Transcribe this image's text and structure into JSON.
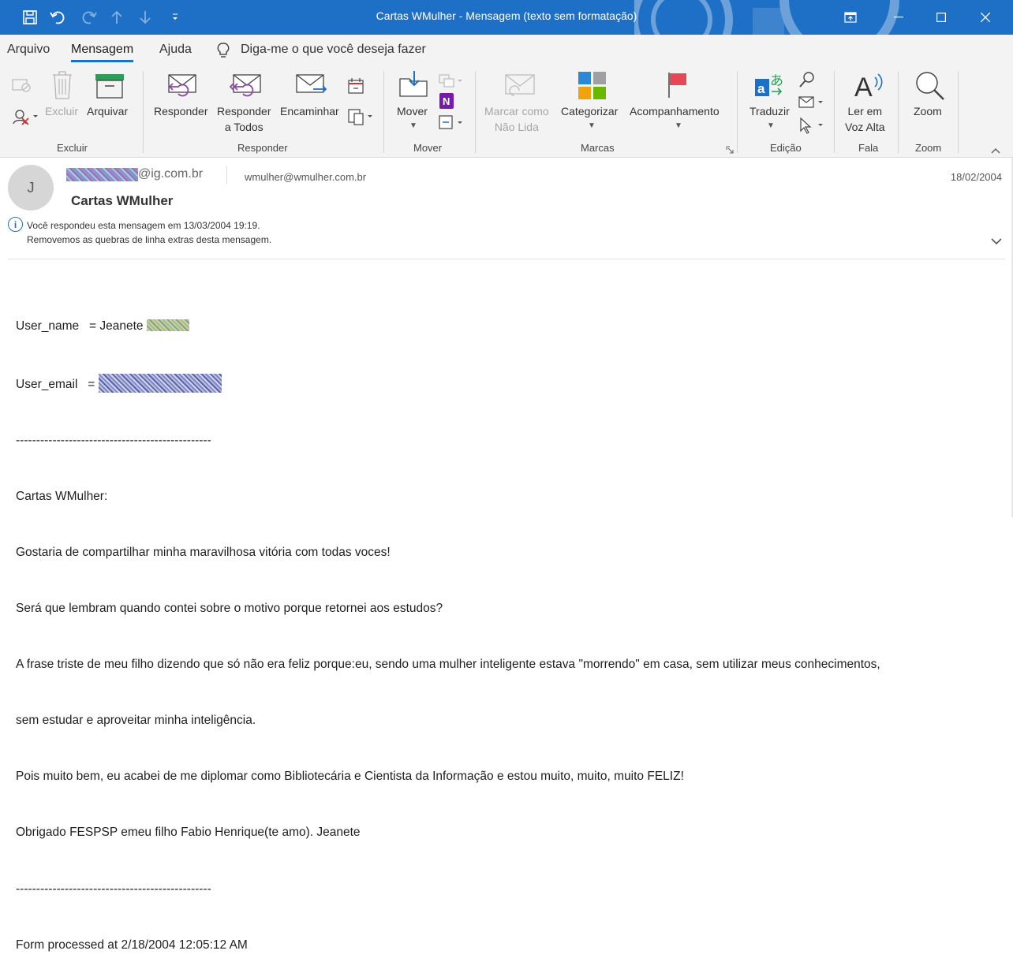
{
  "window": {
    "title": "Cartas WMulher  -  Mensagem (texto sem formatação)",
    "accent": "#1e6fc6"
  },
  "tabs": [
    {
      "label": "Arquivo"
    },
    {
      "label": "Mensagem"
    },
    {
      "label": "Ajuda"
    }
  ],
  "tell_me": "Diga-me o que você deseja fazer",
  "ribbon": {
    "excluir": {
      "delete_label": "Excluir",
      "archive_label": "Arquivar",
      "group": "Excluir"
    },
    "responder": {
      "reply": "Responder",
      "reply_all_1": "Responder",
      "reply_all_2": "a Todos",
      "forward": "Encaminhar",
      "group": "Responder"
    },
    "mover": {
      "move": "Mover",
      "group": "Mover"
    },
    "marcas": {
      "unread_1": "Marcar como",
      "unread_2": "Não Lida",
      "categorize": "Categorizar",
      "follow_up": "Acompanhamento",
      "group": "Marcas"
    },
    "edicao": {
      "translate": "Traduzir",
      "group": "Edição"
    },
    "fala": {
      "read_aloud_1": "Ler em",
      "read_aloud_2": "Voz Alta",
      "group": "Fala"
    },
    "zoom": {
      "zoom": "Zoom",
      "group": "Zoom"
    }
  },
  "message": {
    "avatar_initial": "J",
    "sender_domain": "@ig.com.br",
    "to": "wmulher@wmulher.com.br",
    "date": "18/02/2004",
    "subject": "Cartas WMulher",
    "info_line1": "Você respondeu esta mensagem em 13/03/2004 19:19.",
    "info_line2": "Removemos as quebras de linha extras desta mensagem.",
    "user_name_label": "User_name   = Jeanete",
    "user_email_label": "User_email   =",
    "body_lines": [
      "------------------------------------------------",
      "Cartas WMulher:",
      "Gostaria de compartilhar minha maravilhosa vitória com todas voces!",
      "Será que lembram quando contei sobre o motivo porque retornei aos estudos?",
      "A frase triste de meu filho dizendo que só não era feliz porque:eu, sendo uma mulher inteligente estava \"morrendo\" em casa, sem utilizar meus conhecimentos,",
      "sem estudar e aproveitar minha inteligência.",
      "Pois muito bem, eu acabei de me diplomar como Bibliotecária e Cientista da Informação e estou muito, muito, muito FELIZ!",
      "Obrigado FESPSP emeu filho Fabio Henrique(te amo). Jeanete",
      "------------------------------------------------",
      "Form processed at 2/18/2004 12:05:12 AM"
    ]
  }
}
